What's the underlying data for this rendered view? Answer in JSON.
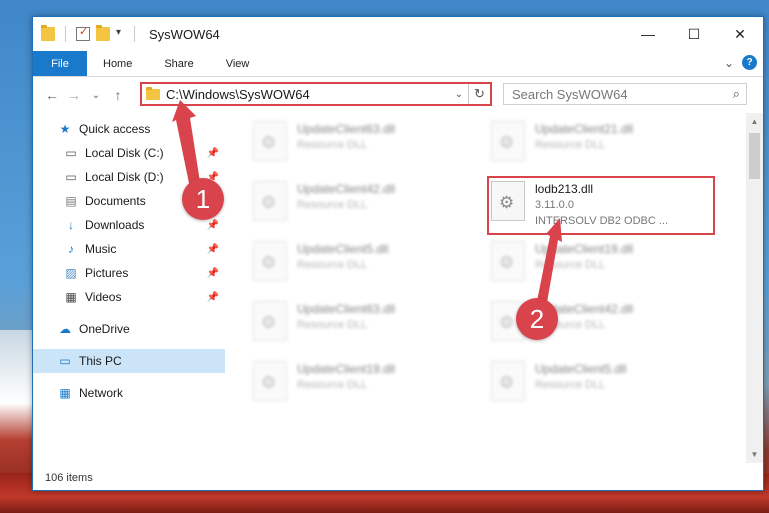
{
  "window": {
    "title": "SysWOW64",
    "controls": {
      "minimize": "—",
      "maximize": "☐",
      "close": "✕"
    }
  },
  "ribbon": {
    "tabs": [
      "File",
      "Home",
      "Share",
      "View"
    ],
    "expand_icon": "⌄",
    "help_icon": "?"
  },
  "nav": {
    "back": "←",
    "forward": "→",
    "recent": "⌄",
    "up": "↑",
    "address_path": "C:\\Windows\\SysWOW64",
    "address_dropdown": "⌄",
    "refresh": "↻",
    "search_placeholder": "Search SysWOW64",
    "search_icon": "⌕"
  },
  "sidebar": {
    "items": [
      {
        "label": "Quick access",
        "icon": "★",
        "pinned": false
      },
      {
        "label": "Local Disk (C:)",
        "icon": "▭",
        "pinned": true
      },
      {
        "label": "Local Disk (D:)",
        "icon": "▭",
        "pinned": true
      },
      {
        "label": "Documents",
        "icon": "▤",
        "pinned": true
      },
      {
        "label": "Downloads",
        "icon": "↓",
        "pinned": true
      },
      {
        "label": "Music",
        "icon": "♪",
        "pinned": true
      },
      {
        "label": "Pictures",
        "icon": "▨",
        "pinned": true
      },
      {
        "label": "Videos",
        "icon": "▦",
        "pinned": true
      },
      {
        "label": "OneDrive",
        "icon": "☁",
        "pinned": false
      },
      {
        "label": "This PC",
        "icon": "▭",
        "pinned": false
      },
      {
        "label": "Network",
        "icon": "▦",
        "pinned": false
      }
    ],
    "pin_icon": "📌"
  },
  "files": {
    "highlighted": {
      "name": "lodb213.dll",
      "version": "3.11.0.0",
      "description": "INTERSOLV DB2 ODBC ..."
    },
    "blurred": [
      {
        "name": "UpdateClient63.dll",
        "type": "Resource DLL"
      },
      {
        "name": "UpdateClient21.dll",
        "type": "Resource DLL"
      },
      {
        "name": "UpdateClient42.dll",
        "type": "Resource DLL"
      },
      {
        "name": "UpdateClient5.dll",
        "type": "Resource DLL"
      },
      {
        "name": "UpdateClient19.dll",
        "type": "Resource DLL"
      },
      {
        "name": "UpdateClient63.dll",
        "type": "Resource DLL"
      },
      {
        "name": "UpdateClient42.dll",
        "type": "Resource DLL"
      },
      {
        "name": "UpdateClient19.dll",
        "type": "Resource DLL"
      },
      {
        "name": "UpdateClient5.dll",
        "type": "Resource DLL"
      }
    ]
  },
  "status": {
    "item_count": "106 items"
  },
  "annotations": {
    "step1": "1",
    "step2": "2",
    "accent": "#d9434b"
  }
}
